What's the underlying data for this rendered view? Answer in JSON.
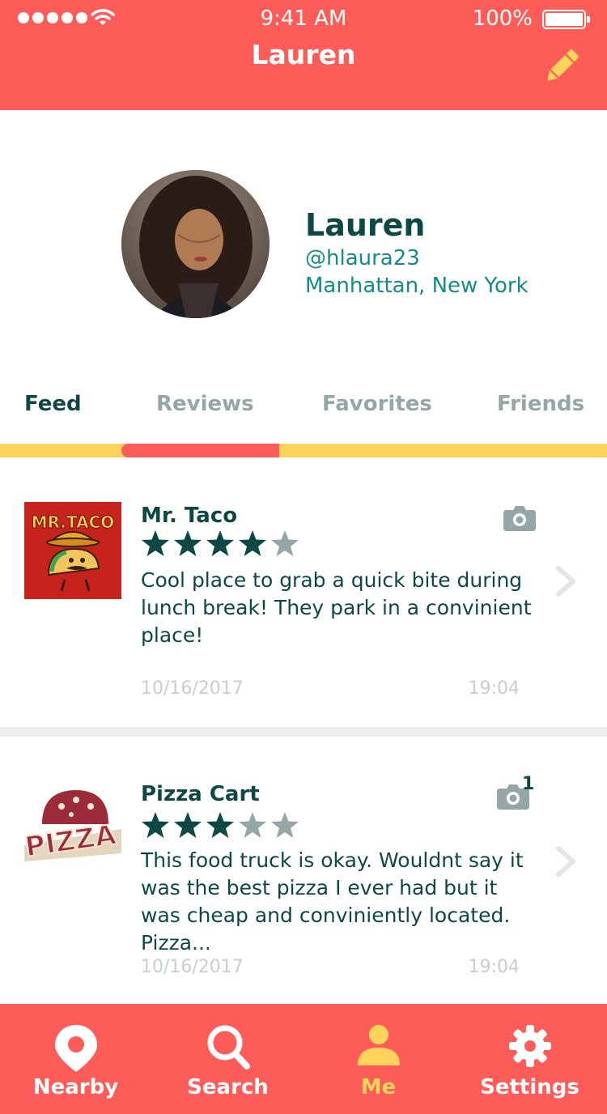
{
  "status_bar": {
    "time": "9:41 AM",
    "battery": "100%"
  },
  "header": {
    "title": "Lauren"
  },
  "profile": {
    "name": "Lauren",
    "handle": "@hlaura23",
    "location": "Manhattan, New York"
  },
  "tabs": [
    {
      "label": "Feed",
      "active": true
    },
    {
      "label": "Reviews",
      "active": false
    },
    {
      "label": "Favorites",
      "active": false
    },
    {
      "label": "Friends",
      "active": false
    }
  ],
  "feed": [
    {
      "title": "Mr. Taco",
      "logo_text": "MR.TACO",
      "rating": 4,
      "max_rating": 5,
      "text": "Cool place to grab a quick bite during lunch break! They park in a convinient place!",
      "date": "10/16/2017",
      "time": "19:04",
      "photo_count": ""
    },
    {
      "title": "Pizza Cart",
      "logo_text": "PIZZA",
      "rating": 3,
      "max_rating": 5,
      "text": "This food truck is okay. Wouldnt say it was the best pizza I ever had but it was cheap and conviniently located. Pizza...",
      "date": "10/16/2017",
      "time": "19:04",
      "photo_count": "1"
    }
  ],
  "bottom_nav": [
    {
      "label": "Nearby",
      "icon": "map-pin-icon",
      "active": false
    },
    {
      "label": "Search",
      "icon": "search-icon",
      "active": false
    },
    {
      "label": "Me",
      "icon": "person-icon",
      "active": true
    },
    {
      "label": "Settings",
      "icon": "gear-icon",
      "active": false
    }
  ],
  "colors": {
    "primary": "#fd5c58",
    "accent": "#fdd35c",
    "text_dark": "#0e4845",
    "text_teal": "#148c87",
    "muted": "#94a7a6"
  }
}
